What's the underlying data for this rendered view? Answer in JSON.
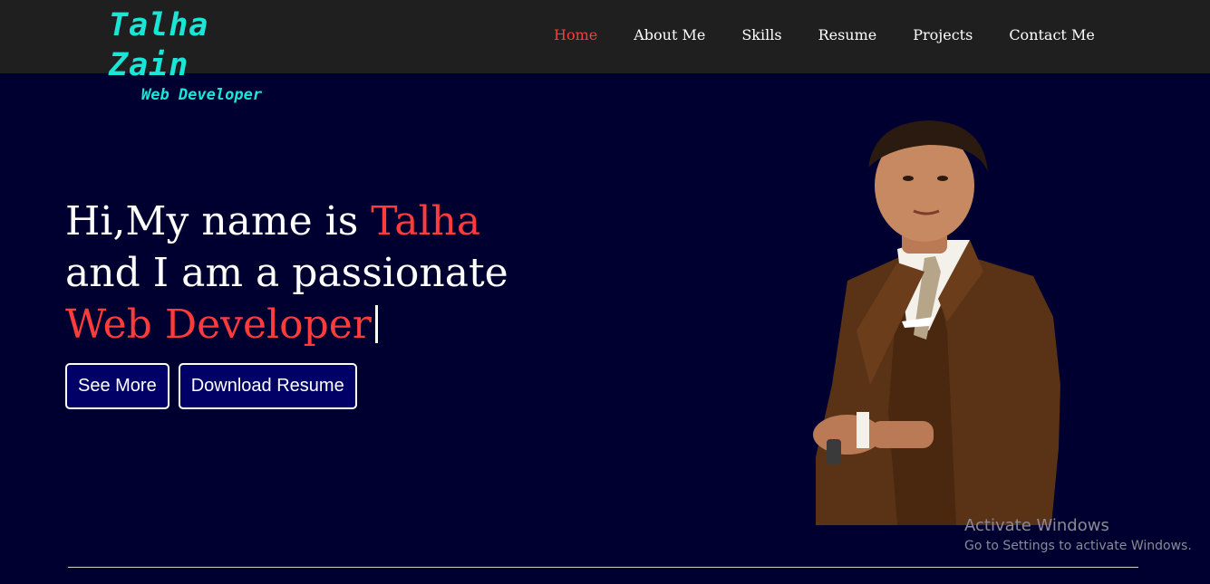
{
  "brand": {
    "name": "Talha Zain",
    "tagline": "Web Developer"
  },
  "nav": {
    "items": [
      {
        "label": "Home",
        "active": true
      },
      {
        "label": "About Me",
        "active": false
      },
      {
        "label": "Skills",
        "active": false
      },
      {
        "label": "Resume",
        "active": false
      },
      {
        "label": "Projects",
        "active": false
      },
      {
        "label": "Contact Me",
        "active": false
      }
    ]
  },
  "hero": {
    "line1_prefix": "Hi,My name is ",
    "line1_name": "Talha",
    "line2": "and I am a passionate",
    "line3_role": "Web Developer",
    "buttons": {
      "see_more": "See More",
      "download_resume": "Download Resume"
    }
  },
  "watermark": {
    "title": "Activate Windows",
    "subtitle": "Go to Settings to activate Windows."
  },
  "colors": {
    "accent": "#ff3b3b",
    "brand": "#19e6d6",
    "background": "#000030",
    "navbar": "#1f1f1f",
    "button": "#000066"
  }
}
